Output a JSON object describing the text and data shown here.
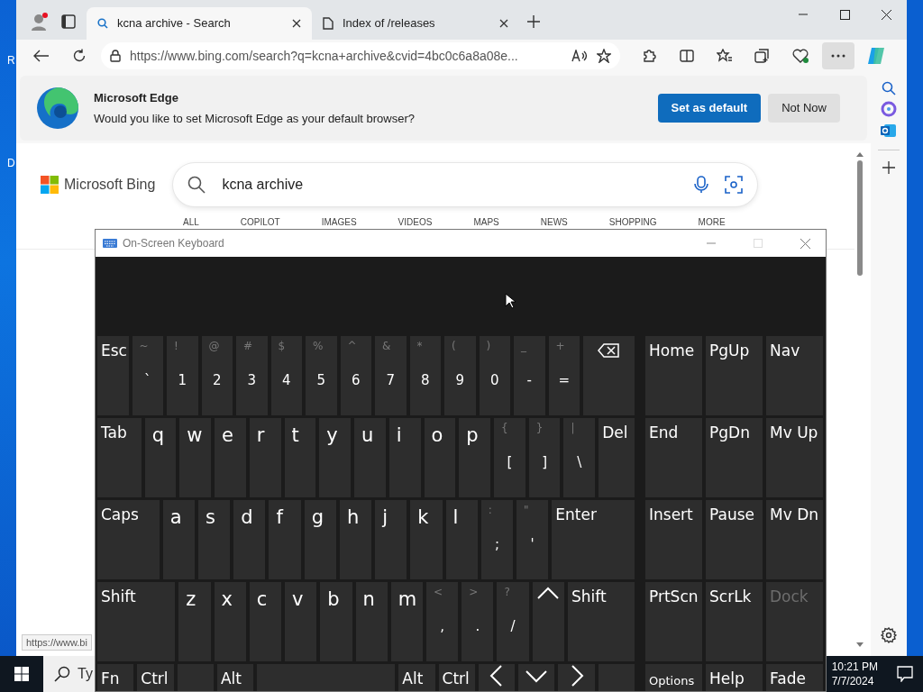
{
  "desktop": {
    "icon_labels": [
      "R",
      "D"
    ]
  },
  "browser": {
    "tabs": [
      {
        "title": "kcna archive - Search",
        "selected": true
      },
      {
        "title": "Index of /releases",
        "selected": false
      }
    ],
    "address": "https://www.bing.com/search?q=kcna+archive&cvid=4bc0c6a8a08e...",
    "infobar": {
      "title": "Microsoft Edge",
      "message": "Would you like to set Microsoft Edge as your default browser?",
      "buttons": [
        {
          "label": "Set as default",
          "primary": true
        },
        {
          "label": "Not Now",
          "primary": false
        }
      ]
    },
    "bing": {
      "brand": "Microsoft Bing",
      "query": "kcna archive",
      "nav": [
        "ALL",
        "COPILOT",
        "IMAGES",
        "VIDEOS",
        "MAPS",
        "NEWS",
        "SHOPPING",
        "MORE"
      ]
    },
    "status_url": "https://www.bi"
  },
  "keyboard": {
    "title": "On-Screen Keyboard",
    "main_rows": [
      [
        {
          "label": "Esc",
          "kind": "esc"
        },
        {
          "top": "~",
          "label": "`",
          "kind": "char"
        },
        {
          "top": "!",
          "label": "1",
          "kind": "char"
        },
        {
          "top": "@",
          "label": "2",
          "kind": "char"
        },
        {
          "top": "#",
          "label": "3",
          "kind": "char"
        },
        {
          "top": "$",
          "label": "4",
          "kind": "char"
        },
        {
          "top": "%",
          "label": "5",
          "kind": "char"
        },
        {
          "top": "^",
          "label": "6",
          "kind": "char"
        },
        {
          "top": "&",
          "label": "7",
          "kind": "char"
        },
        {
          "top": "*",
          "label": "8",
          "kind": "char"
        },
        {
          "top": "(",
          "label": "9",
          "kind": "char"
        },
        {
          "top": ")",
          "label": "0",
          "kind": "char"
        },
        {
          "top": "_",
          "label": "-",
          "kind": "char"
        },
        {
          "top": "+",
          "label": "=",
          "kind": "char"
        },
        {
          "kind": "backspace"
        }
      ],
      [
        {
          "label": "Tab",
          "kind": "tab"
        },
        {
          "label": "q",
          "kind": "char"
        },
        {
          "label": "w",
          "kind": "char"
        },
        {
          "label": "e",
          "kind": "char"
        },
        {
          "label": "r",
          "kind": "char"
        },
        {
          "label": "t",
          "kind": "char"
        },
        {
          "label": "y",
          "kind": "char"
        },
        {
          "label": "u",
          "kind": "char"
        },
        {
          "label": "i",
          "kind": "char"
        },
        {
          "label": "o",
          "kind": "char"
        },
        {
          "label": "p",
          "kind": "char"
        },
        {
          "top": "{",
          "label": "[",
          "kind": "char"
        },
        {
          "top": "}",
          "label": "]",
          "kind": "char"
        },
        {
          "top": "|",
          "label": "\\",
          "kind": "char"
        },
        {
          "label": "Del",
          "kind": "del"
        }
      ],
      [
        {
          "label": "Caps",
          "kind": "caps"
        },
        {
          "label": "a",
          "kind": "char"
        },
        {
          "label": "s",
          "kind": "char"
        },
        {
          "label": "d",
          "kind": "char"
        },
        {
          "label": "f",
          "kind": "char"
        },
        {
          "label": "g",
          "kind": "char"
        },
        {
          "label": "h",
          "kind": "char"
        },
        {
          "label": "j",
          "kind": "char"
        },
        {
          "label": "k",
          "kind": "char"
        },
        {
          "label": "l",
          "kind": "char"
        },
        {
          "top": ":",
          "label": ";",
          "kind": "char"
        },
        {
          "top": "\"",
          "label": "'",
          "kind": "char"
        },
        {
          "label": "Enter",
          "kind": "enter"
        }
      ],
      [
        {
          "label": "Shift",
          "kind": "lshift"
        },
        {
          "label": "z",
          "kind": "char"
        },
        {
          "label": "x",
          "kind": "char"
        },
        {
          "label": "c",
          "kind": "char"
        },
        {
          "label": "v",
          "kind": "char"
        },
        {
          "label": "b",
          "kind": "char"
        },
        {
          "label": "n",
          "kind": "char"
        },
        {
          "label": "m",
          "kind": "char"
        },
        {
          "top": "<",
          "label": ",",
          "kind": "char"
        },
        {
          "top": ">",
          "label": ".",
          "kind": "char"
        },
        {
          "top": "?",
          "label": "/",
          "kind": "char"
        },
        {
          "kind": "up"
        },
        {
          "label": "Shift",
          "kind": "rshift"
        }
      ],
      [
        {
          "label": "Fn",
          "kind": "mod"
        },
        {
          "label": "Ctrl",
          "kind": "mod"
        },
        {
          "kind": "blank"
        },
        {
          "label": "Alt",
          "kind": "mod"
        },
        {
          "kind": "space"
        },
        {
          "label": "Alt",
          "kind": "mod"
        },
        {
          "label": "Ctrl",
          "kind": "mod"
        },
        {
          "kind": "left"
        },
        {
          "kind": "down"
        },
        {
          "kind": "right"
        },
        {
          "kind": "blank"
        }
      ]
    ],
    "side_rows": [
      [
        {
          "label": "Home",
          "disabled": false
        },
        {
          "label": "PgUp",
          "disabled": false
        },
        {
          "label": "Nav",
          "disabled": false
        }
      ],
      [
        {
          "label": "End",
          "disabled": false
        },
        {
          "label": "PgDn",
          "disabled": false
        },
        {
          "label": "Mv Up",
          "disabled": false
        }
      ],
      [
        {
          "label": "Insert",
          "disabled": false
        },
        {
          "label": "Pause",
          "disabled": false
        },
        {
          "label": "Mv Dn",
          "disabled": false
        }
      ],
      [
        {
          "label": "PrtScn",
          "disabled": false
        },
        {
          "label": "ScrLk",
          "disabled": false
        },
        {
          "label": "Dock",
          "disabled": true
        }
      ],
      [
        {
          "label": "Options",
          "disabled": false
        },
        {
          "label": "Help",
          "disabled": false
        },
        {
          "label": "Fade",
          "disabled": false
        }
      ]
    ]
  },
  "taskbar": {
    "search_placeholder": "Ty",
    "time": "10:21 PM",
    "date": "7/7/2024"
  }
}
